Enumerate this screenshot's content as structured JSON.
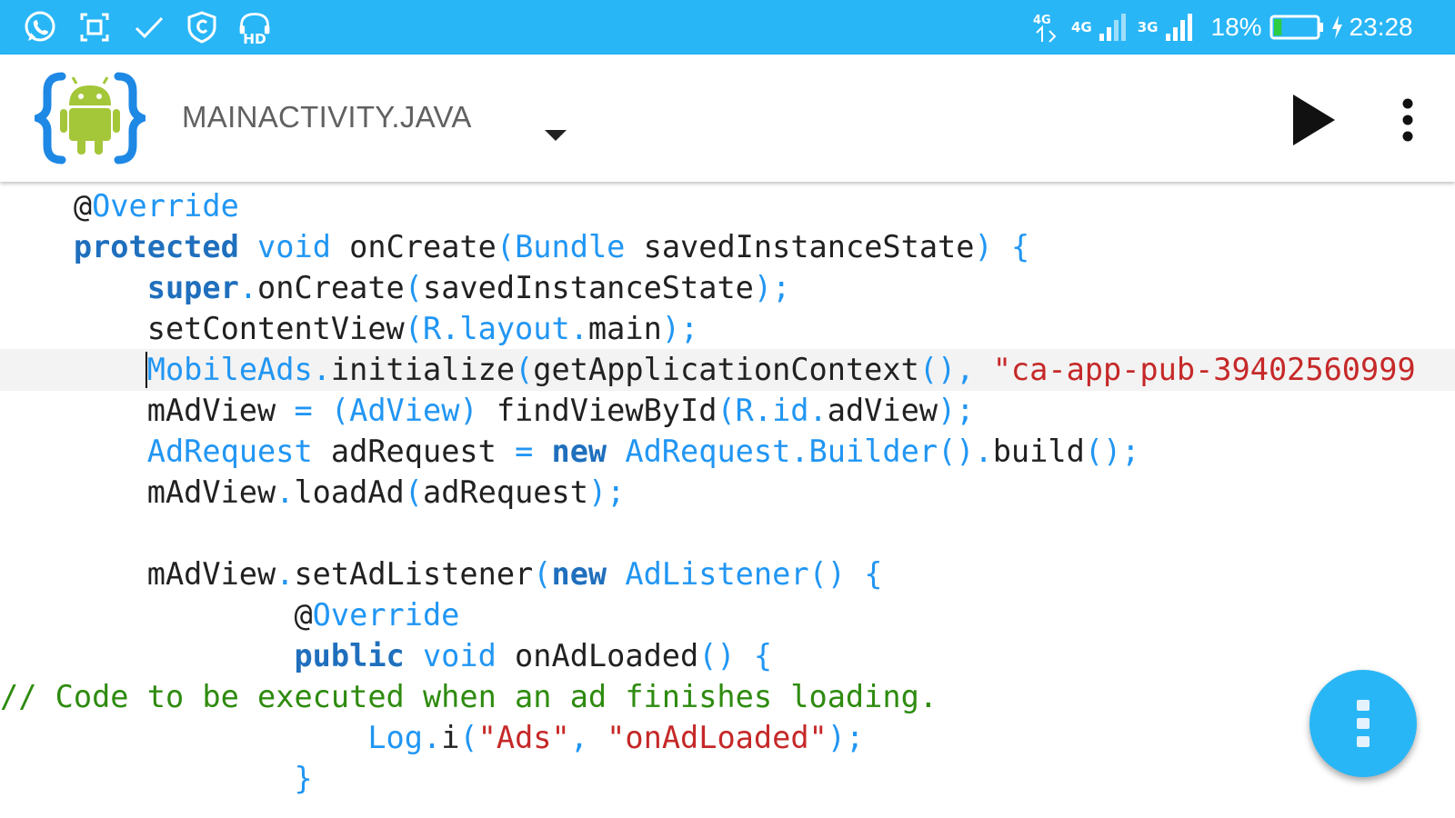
{
  "status_bar": {
    "battery_percent": "18%",
    "time": "23:28",
    "network_labels": [
      "4G",
      "4G",
      "3G"
    ],
    "icons": [
      "whatsapp-icon",
      "screenshot-icon",
      "check-icon",
      "shield-icon",
      "hd-headset-icon",
      "data-arrows-icon",
      "signal-icon",
      "battery-icon",
      "charging-icon"
    ],
    "battery_level": 0.18
  },
  "app_bar": {
    "file_name": "MAINACTIVITY.JAVA",
    "icons": [
      "android-logo",
      "dropdown-arrow-icon",
      "run-icon",
      "more-vert-icon"
    ]
  },
  "editor": {
    "lines": [
      [
        [
          "pl",
          "    @"
        ],
        [
          "ty",
          "Override"
        ]
      ],
      [
        [
          "pl",
          "    "
        ],
        [
          "kw",
          "protected"
        ],
        [
          "pl",
          " "
        ],
        [
          "ty",
          "void"
        ],
        [
          "pl",
          " onCreate"
        ],
        [
          "pu",
          "("
        ],
        [
          "ty",
          "Bundle"
        ],
        [
          "pl",
          " savedInstanceState"
        ],
        [
          "pu",
          ")"
        ],
        [
          "pl",
          " "
        ],
        [
          "pu",
          "{"
        ]
      ],
      [
        [
          "pl",
          "        "
        ],
        [
          "kw",
          "super"
        ],
        [
          "pu",
          "."
        ],
        [
          "pl",
          "onCreate"
        ],
        [
          "pu",
          "("
        ],
        [
          "pl",
          "savedInstanceState"
        ],
        [
          "pu",
          ");"
        ]
      ],
      [
        [
          "pl",
          "        setContentView"
        ],
        [
          "pu",
          "("
        ],
        [
          "ty",
          "R"
        ],
        [
          "pu",
          "."
        ],
        [
          "ty",
          "layout"
        ],
        [
          "pu",
          "."
        ],
        [
          "pl",
          "main"
        ],
        [
          "pu",
          ");"
        ]
      ],
      [
        [
          "pl",
          "        "
        ],
        [
          "ty",
          "MobileAds"
        ],
        [
          "pu",
          "."
        ],
        [
          "pl",
          "initialize"
        ],
        [
          "pu",
          "("
        ],
        [
          "pl",
          "getApplicationContext"
        ],
        [
          "pu",
          "(),"
        ],
        [
          "pl",
          " "
        ],
        [
          "st",
          "\"ca-app-pub-39402560999"
        ]
      ],
      [
        [
          "pl",
          "        mAdView "
        ],
        [
          "pu",
          "="
        ],
        [
          "pl",
          " "
        ],
        [
          "pu",
          "("
        ],
        [
          "ty",
          "AdView"
        ],
        [
          "pu",
          ")"
        ],
        [
          "pl",
          " findViewById"
        ],
        [
          "pu",
          "("
        ],
        [
          "ty",
          "R"
        ],
        [
          "pu",
          "."
        ],
        [
          "ty",
          "id"
        ],
        [
          "pu",
          "."
        ],
        [
          "pl",
          "adView"
        ],
        [
          "pu",
          ");"
        ]
      ],
      [
        [
          "pl",
          "        "
        ],
        [
          "ty",
          "AdRequest"
        ],
        [
          "pl",
          " adRequest "
        ],
        [
          "pu",
          "="
        ],
        [
          "pl",
          " "
        ],
        [
          "kw",
          "new"
        ],
        [
          "pl",
          " "
        ],
        [
          "ty",
          "AdRequest"
        ],
        [
          "pu",
          "."
        ],
        [
          "ty",
          "Builder"
        ],
        [
          "pu",
          "()."
        ],
        [
          "pl",
          "build"
        ],
        [
          "pu",
          "();"
        ]
      ],
      [
        [
          "pl",
          "        mAdView"
        ],
        [
          "pu",
          "."
        ],
        [
          "pl",
          "loadAd"
        ],
        [
          "pu",
          "("
        ],
        [
          "pl",
          "adRequest"
        ],
        [
          "pu",
          ");"
        ]
      ],
      [
        [
          "pl",
          ""
        ]
      ],
      [
        [
          "pl",
          "        mAdView"
        ],
        [
          "pu",
          "."
        ],
        [
          "pl",
          "setAdListener"
        ],
        [
          "pu",
          "("
        ],
        [
          "kw",
          "new"
        ],
        [
          "pl",
          " "
        ],
        [
          "ty",
          "AdListener"
        ],
        [
          "pu",
          "()"
        ],
        [
          "pl",
          " "
        ],
        [
          "pu",
          "{"
        ]
      ],
      [
        [
          "pl",
          "                @"
        ],
        [
          "ty",
          "Override"
        ]
      ],
      [
        [
          "pl",
          "                "
        ],
        [
          "kw",
          "public"
        ],
        [
          "pl",
          " "
        ],
        [
          "ty",
          "void"
        ],
        [
          "pl",
          " onAdLoaded"
        ],
        [
          "pu",
          "()"
        ],
        [
          "pl",
          " "
        ],
        [
          "pu",
          "{"
        ]
      ],
      [
        [
          "cm",
          "// Code to be executed when an ad finishes loading."
        ]
      ],
      [
        [
          "pl",
          "                    "
        ],
        [
          "ty",
          "Log"
        ],
        [
          "pu",
          "."
        ],
        [
          "pl",
          "i"
        ],
        [
          "pu",
          "("
        ],
        [
          "st",
          "\"Ads\""
        ],
        [
          "pu",
          ","
        ],
        [
          "pl",
          " "
        ],
        [
          "st",
          "\"onAdLoaded\""
        ],
        [
          "pu",
          ");"
        ]
      ],
      [
        [
          "pl",
          "                "
        ],
        [
          "pu",
          "}"
        ]
      ]
    ],
    "current_line": 5,
    "colors": {
      "keyword": "#1f6fbd",
      "type": "#2196f3",
      "string": "#c62828",
      "comment": "#2e8b0f",
      "text": "#212121"
    }
  },
  "fab": {
    "icon": "more-vert-icon",
    "color": "#29b6f6"
  },
  "theme": {
    "status_bar_color": "#29b6f6",
    "app_bar_color": "#ffffff",
    "title_color": "#616161"
  }
}
